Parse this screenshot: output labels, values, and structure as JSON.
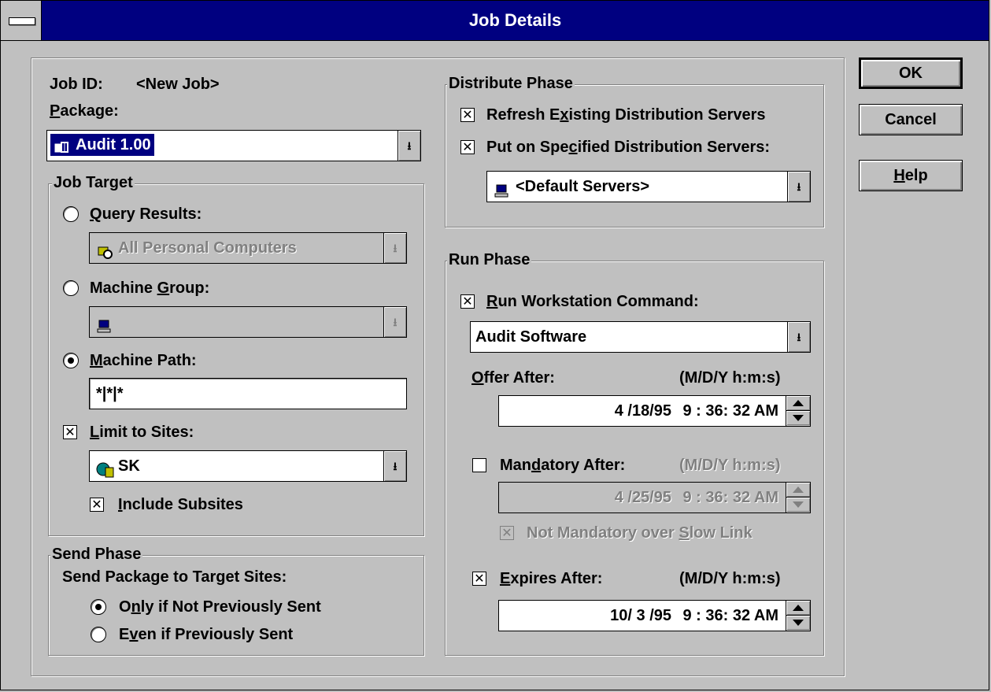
{
  "window": {
    "title": "Job Details"
  },
  "buttons": {
    "ok": "OK",
    "cancel": "Cancel",
    "help": "Help"
  },
  "job": {
    "id_label": "Job ID:",
    "id_value": "<New Job>",
    "package_label": "Package:",
    "package_value": "Audit 1.00"
  },
  "job_target": {
    "group_label": "Job Target",
    "query_results": {
      "label": "Query Results:",
      "value": "All Personal Computers",
      "selected": false
    },
    "machine_group": {
      "label": "Machine Group:",
      "value": "",
      "selected": false
    },
    "machine_path": {
      "label": "Machine Path:",
      "value": "*|*|*",
      "selected": true
    },
    "limit_to_sites": {
      "label": "Limit to Sites:",
      "checked": true,
      "value": "SK"
    },
    "include_subsites": {
      "label": "Include Subsites",
      "checked": true
    }
  },
  "send_phase": {
    "group_label": "Send Phase",
    "prompt": "Send Package to Target Sites:",
    "options": [
      {
        "label": "Only if Not Previously Sent",
        "selected": true
      },
      {
        "label": "Even if Previously Sent",
        "selected": false
      }
    ]
  },
  "distribute_phase": {
    "group_label": "Distribute Phase",
    "refresh_existing": {
      "label": "Refresh Existing Distribution Servers",
      "checked": true
    },
    "put_on_specified": {
      "label": "Put on Specified Distribution Servers:",
      "checked": true
    },
    "servers_value": "<Default Servers>"
  },
  "run_phase": {
    "group_label": "Run Phase",
    "run_command": {
      "label": "Run Workstation Command:",
      "checked": true,
      "value": "Audit Software"
    },
    "offer_after": {
      "label": "Offer After:",
      "format": "(M/D/Y h:m:s)",
      "date": "4 /18/95",
      "time": "9 : 36: 32 AM"
    },
    "mandatory_after": {
      "label": "Mandatory After:",
      "checked": false,
      "format": "(M/D/Y h:m:s)",
      "date": "4 /25/95",
      "time": "9 : 36: 32 AM"
    },
    "not_mandatory_slow": {
      "label": "Not Mandatory over Slow Link",
      "checked": true
    },
    "expires_after": {
      "label": "Expires After:",
      "checked": true,
      "format": "(M/D/Y h:m:s)",
      "date": "10/ 3 /95",
      "time": "9 : 36: 32 AM"
    }
  },
  "icons": {
    "system_menu": "system-menu-icon",
    "package": "package-icon",
    "query": "query-icon",
    "machine_group": "computer-icon",
    "site": "site-icon",
    "servers": "server-icon",
    "dropdown": "down-arrow-icon",
    "spinner": "spin-arrows-icon"
  },
  "colors": {
    "face": "#c0c0c0",
    "title_bar": "#000080",
    "highlight": "#000080",
    "disabled_text": "#808080"
  }
}
